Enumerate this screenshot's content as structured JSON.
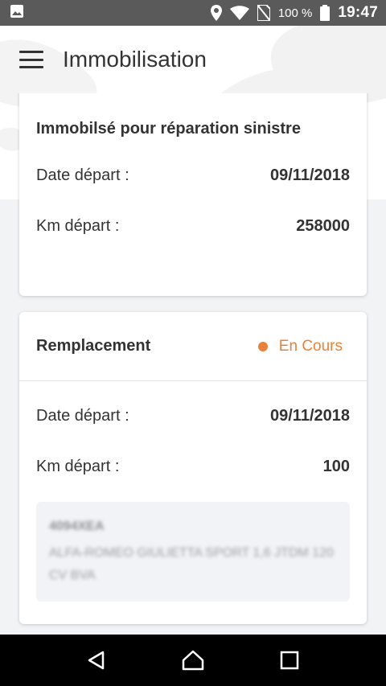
{
  "status_bar": {
    "battery_percent": "100 %",
    "time": "19:47"
  },
  "app_bar": {
    "title": "Immobilisation"
  },
  "immobilisation_card": {
    "heading": "Immobilsé pour réparation sinistre",
    "rows": [
      {
        "label": "Date départ :",
        "value": "09/11/2018"
      },
      {
        "label": "Km départ :",
        "value": "258000"
      }
    ]
  },
  "replacement_card": {
    "heading": "Remplacement",
    "status": "En Cours",
    "status_color": "#e8823a",
    "rows": [
      {
        "label": "Date départ :",
        "value": "09/11/2018"
      },
      {
        "label": "Km départ :",
        "value": "100"
      }
    ],
    "vehicle": {
      "plate": "4094XEA",
      "model": "ALFA-ROMEO GIULIETTA SPORT 1,6 JTDM 120 CV BVA"
    }
  },
  "nav_bar": {
    "back": "back-icon",
    "home": "home-icon",
    "recents": "recents-icon"
  }
}
